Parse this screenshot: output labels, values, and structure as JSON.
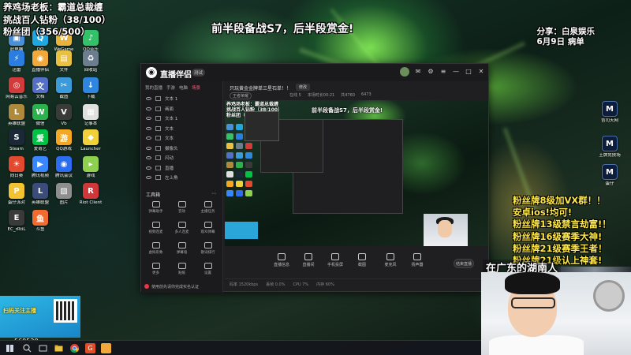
{
  "overlays": {
    "top_left": [
      "养鸡场老板：霸道总裁缠",
      "挑战百人钻粉（38/100）",
      "粉丝团（356/500）"
    ],
    "top_center": "前半段备战S7，后半段赏金!",
    "top_right": [
      "分享：白泉娱乐",
      "6月9日 病单"
    ],
    "right_list": [
      "粉丝牌8级加VX群！！",
      "安卓ios!均可!",
      "粉丝牌13级禁言劫富!！",
      "粉丝牌16级赛季大神!",
      "粉丝牌21级赛季王者！",
      "粉丝牌21级认上神套!"
    ],
    "cam_caption": "在广东的湖南人"
  },
  "desktop_icons": [
    {
      "label": "此电脑",
      "icon": "computer-icon",
      "color": "#4a90d9",
      "glyph": "▣"
    },
    {
      "label": "QQ",
      "icon": "qq-icon",
      "color": "#1fa7e1",
      "glyph": "Q"
    },
    {
      "label": "WeGame",
      "icon": "wegame-icon",
      "color": "#e8b33a",
      "glyph": "W"
    },
    {
      "label": "QQ音乐",
      "icon": "qqmusic-icon",
      "color": "#33c26a",
      "glyph": "♪"
    },
    {
      "label": "迅雷",
      "icon": "xunlei-icon",
      "color": "#2a7de1",
      "glyph": "⚡"
    },
    {
      "label": "直播伴侣",
      "icon": "live-icon",
      "color": "#f2a93b",
      "glyph": "◉"
    },
    {
      "label": "文件",
      "icon": "folder-icon",
      "color": "#e9c040",
      "glyph": "▤"
    },
    {
      "label": "回收站",
      "icon": "recycle-icon",
      "color": "#6b7d8f",
      "glyph": "♻"
    },
    {
      "label": "网易云音乐",
      "icon": "netease-icon",
      "color": "#d23b3b",
      "glyph": "◎"
    },
    {
      "label": "文档",
      "icon": "doc-icon",
      "color": "#5470c6",
      "glyph": "文"
    },
    {
      "label": "截图",
      "icon": "screenshot-icon",
      "color": "#3b9ad9",
      "glyph": "✂"
    },
    {
      "label": "下载",
      "icon": "download-icon",
      "color": "#2e86de",
      "glyph": "↓"
    },
    {
      "label": "英雄联盟",
      "icon": "lol-icon",
      "color": "#b08a3c",
      "glyph": "L"
    },
    {
      "label": "微信",
      "icon": "wechat-icon",
      "color": "#2bb24c",
      "glyph": "W"
    },
    {
      "label": "Vb",
      "icon": "vb-icon",
      "color": "#3a3a3a",
      "glyph": "V"
    },
    {
      "label": "记事本",
      "icon": "notepad-icon",
      "color": "#e0e0e0",
      "glyph": "▦"
    },
    {
      "label": "Steam",
      "icon": "steam-icon",
      "color": "#1b2838",
      "glyph": "S"
    },
    {
      "label": "爱奇艺",
      "icon": "iqiyi-icon",
      "color": "#00c244",
      "glyph": "爱"
    },
    {
      "label": "QQ游戏",
      "icon": "qqgame-icon",
      "color": "#f5a623",
      "glyph": "游"
    },
    {
      "label": "Launcher",
      "icon": "launcher-icon",
      "color": "#f0d13a",
      "glyph": "◆"
    },
    {
      "label": "向日葵",
      "icon": "sunflower-icon",
      "color": "#e24a2f",
      "glyph": "☀"
    },
    {
      "label": "腾讯视频",
      "icon": "tencent-video-icon",
      "color": "#3a86ff",
      "glyph": "▶"
    },
    {
      "label": "腾讯会议",
      "icon": "meeting-icon",
      "color": "#2b6cf0",
      "glyph": "◉"
    },
    {
      "label": "游戏",
      "icon": "game-icon",
      "color": "#8fd14f",
      "glyph": "▸"
    },
    {
      "label": "蛋仔派对",
      "icon": "eggy-icon",
      "color": "#f4c430",
      "glyph": "P"
    },
    {
      "label": "英雄联盟",
      "icon": "lol2-icon",
      "color": "#3b4c7a",
      "glyph": "L"
    },
    {
      "label": "图片",
      "icon": "image-icon",
      "color": "#8e8e8e",
      "glyph": "▧"
    },
    {
      "label": "Riot Client",
      "icon": "riot-icon",
      "color": "#d13639",
      "glyph": "R"
    },
    {
      "label": "EC_rRtiL",
      "icon": "ec-icon",
      "color": "#3a3a3a",
      "glyph": "E"
    },
    {
      "label": "斗鱼",
      "icon": "douyu-icon",
      "color": "#f06b2f",
      "glyph": "鱼"
    }
  ],
  "right_icons": [
    {
      "label": "吉司天网",
      "icon": "app-right-1-icon"
    },
    {
      "label": "王牌竞技场",
      "icon": "app-right-2-icon"
    },
    {
      "label": "蛋仔",
      "icon": "app-right-3-icon"
    }
  ],
  "app": {
    "name": "直播伴侣",
    "version": "测试",
    "left_tabs": [
      "我的直播",
      "手游",
      "电脑",
      "场景"
    ],
    "scenes": [
      "文本 1",
      "画面",
      "文本 1",
      "文本",
      "文本",
      "摄像头",
      "闪动",
      "直播",
      "左上角"
    ],
    "tools_title": "工具箱",
    "tools": [
      "弹幕助手",
      "音效",
      "主播任务",
      "视频连麦",
      "多人连麦",
      "观众弹幕",
      "虚拟形象",
      "弹幕墙",
      "歌词排行",
      "更多",
      "贴纸",
      "设置"
    ],
    "bottom_notice": "使用前先请你完成实名认证",
    "stream_title": "只玩黄金金牌单三星石单！！",
    "modify_label": "修改",
    "category": "王者荣耀",
    "stats": [
      "在线 5",
      "本场时长00:21",
      "共4760",
      "6473"
    ],
    "controls": [
      "直播信息",
      "直播间",
      "手机投屏",
      "截图",
      "麦克风",
      "扬声器"
    ],
    "start_label": "结束直播",
    "status": [
      "码率 1520kbps",
      "丢帧 0.0%",
      "CPU 7%",
      "内存 60%"
    ]
  },
  "qr_text": "扫码关注主播",
  "counter": "560520",
  "colors": {
    "accent": "#ff5a7a",
    "highlight": "#ffe94a"
  }
}
